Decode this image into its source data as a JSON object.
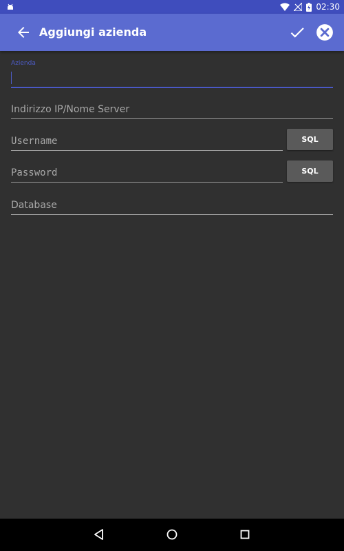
{
  "status_bar": {
    "time": "02:30",
    "icons": [
      "android-debug-icon",
      "wifi-icon",
      "no-signal-icon",
      "battery-charging-icon"
    ]
  },
  "app_bar": {
    "title": "Aggiungi azienda",
    "icons": [
      "back-arrow-icon",
      "check-icon",
      "close-circle-icon"
    ]
  },
  "form": {
    "azienda": {
      "label": "Azienda",
      "value": ""
    },
    "indirizzo": {
      "placeholder": "Indirizzo IP/Nome Server",
      "value": ""
    },
    "username": {
      "placeholder": "Username",
      "value": ""
    },
    "password": {
      "placeholder": "Password",
      "value": ""
    },
    "database": {
      "placeholder": "Database",
      "value": ""
    },
    "sql_button_label": "SQL"
  },
  "nav_bar": {
    "icons": [
      "nav-back-icon",
      "nav-home-icon",
      "nav-recents-icon"
    ]
  },
  "colors": {
    "status_bar": "#3f4dbd",
    "app_bar": "#5b6bd0",
    "accent": "#4a58c5",
    "background": "#303030",
    "button": "#5a5a5a"
  }
}
